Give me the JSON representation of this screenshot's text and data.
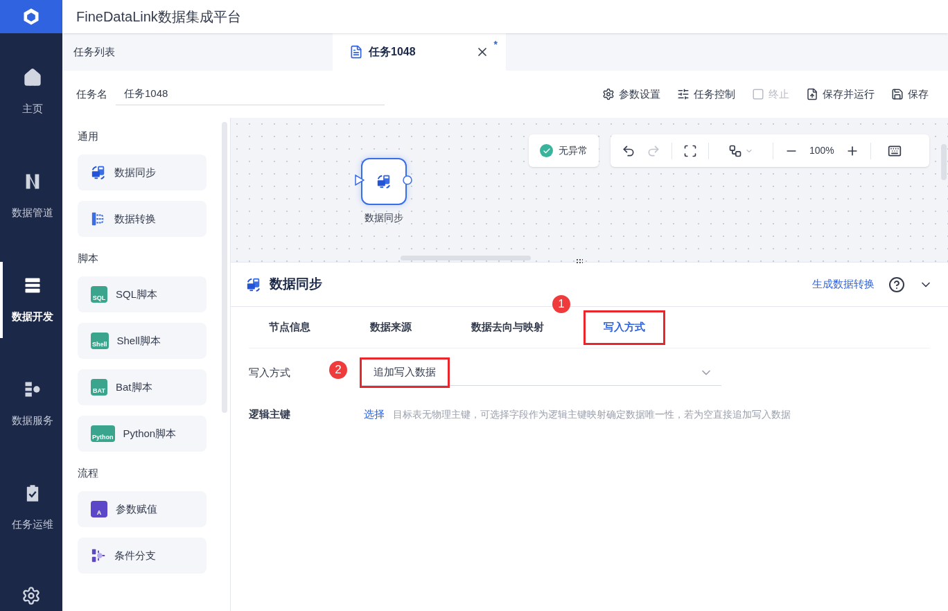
{
  "app_title": "FineDataLink数据集成平台",
  "nav": [
    {
      "label": "主页",
      "selected": false
    },
    {
      "label": "数据管道",
      "selected": false
    },
    {
      "label": "数据开发",
      "selected": true
    },
    {
      "label": "数据服务",
      "selected": false
    },
    {
      "label": "任务运维",
      "selected": false
    }
  ],
  "doc_tabs": [
    {
      "label": "任务列表",
      "selected": false
    },
    {
      "label": "任务1048",
      "selected": true,
      "modified_mark": "*"
    }
  ],
  "task_name": {
    "label": "任务名",
    "value": "任务1048"
  },
  "actions": [
    {
      "label": "参数设置",
      "disabled": false
    },
    {
      "label": "任务控制",
      "disabled": false
    },
    {
      "label": "终止",
      "disabled": true
    },
    {
      "label": "保存并运行",
      "disabled": false
    },
    {
      "label": "保存",
      "disabled": false
    }
  ],
  "palette": [
    {
      "heading": "通用",
      "items": [
        {
          "label": "数据同步",
          "kind": "sync"
        },
        {
          "label": "数据转换",
          "kind": "transform"
        }
      ]
    },
    {
      "heading": "脚本",
      "items": [
        {
          "label": "SQL脚本",
          "kind": "script",
          "badge": "SQL"
        },
        {
          "label": "Shell脚本",
          "kind": "script",
          "badge": "Shell"
        },
        {
          "label": "Bat脚本",
          "kind": "script",
          "badge": "BAT"
        },
        {
          "label": "Python脚本",
          "kind": "script",
          "badge": "Python"
        }
      ]
    },
    {
      "heading": "流程",
      "items": [
        {
          "label": "参数赋值",
          "kind": "assign",
          "badge": "A"
        },
        {
          "label": "条件分支",
          "kind": "branch"
        }
      ]
    }
  ],
  "canvas": {
    "status": "无异常",
    "zoom": "100%",
    "nodes": [
      {
        "label": "数据同步",
        "selected": true
      }
    ]
  },
  "detail": {
    "title": "数据同步",
    "link": "生成数据转换",
    "tabs": [
      {
        "label": "节点信息",
        "selected": false,
        "highlighted": false
      },
      {
        "label": "数据来源",
        "selected": false,
        "highlighted": false
      },
      {
        "label": "数据去向与映射",
        "selected": false,
        "highlighted": false
      },
      {
        "label": "写入方式",
        "selected": true,
        "highlighted": true,
        "step": "1"
      }
    ],
    "write_mode": {
      "label": "写入方式",
      "value": "追加写入数据",
      "highlighted": true,
      "step": "2"
    },
    "logic_key": {
      "label": "逻辑主键",
      "link": "选择",
      "hint": "目标表无物理主键，可选择字段作为逻辑主键映射确定数据唯一性，若为空直接追加写入数据"
    }
  }
}
